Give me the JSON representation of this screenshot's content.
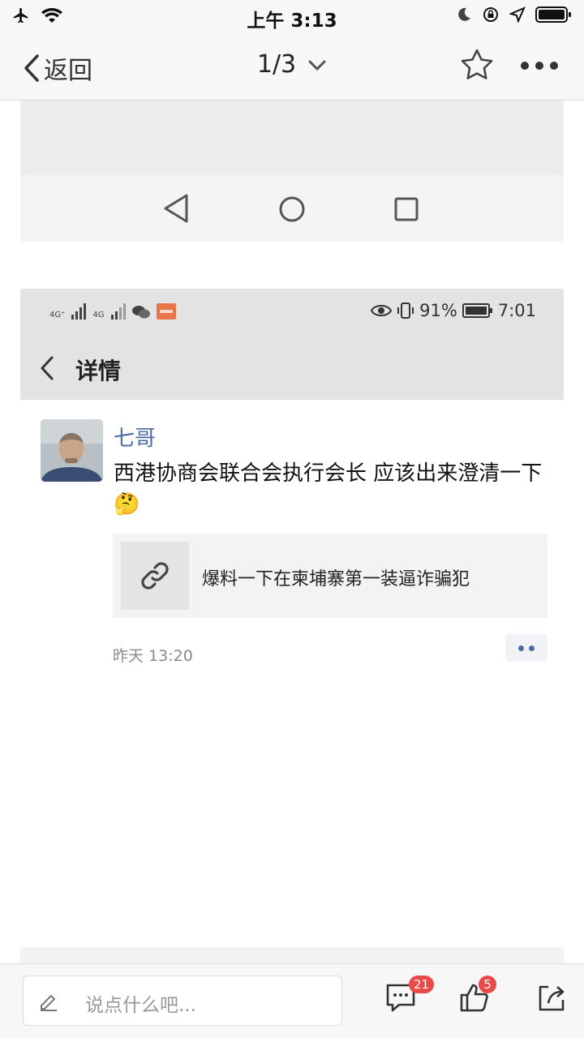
{
  "ios_status": {
    "time": "上午 3:13"
  },
  "nav": {
    "back_label": "返回",
    "pager": "1/3"
  },
  "android_status": {
    "battery_pct": "91%",
    "time": "7:01",
    "signal_1": "4G⁺",
    "signal_2": "4G"
  },
  "android_header": {
    "title": "详情"
  },
  "post": {
    "author": "七哥",
    "text": "西港协商会联合会执行会长 应该出来澄清一下🤔",
    "link_title": "爆料一下在柬埔寨第一装逼诈骗犯",
    "time": "昨天 13:20"
  },
  "bottom_bar": {
    "comment_placeholder": "说点什么吧...",
    "comment_count": "21",
    "like_count": "5"
  },
  "colors": {
    "author_blue": "#4a6aa5",
    "badge_red": "#e84a4a"
  }
}
